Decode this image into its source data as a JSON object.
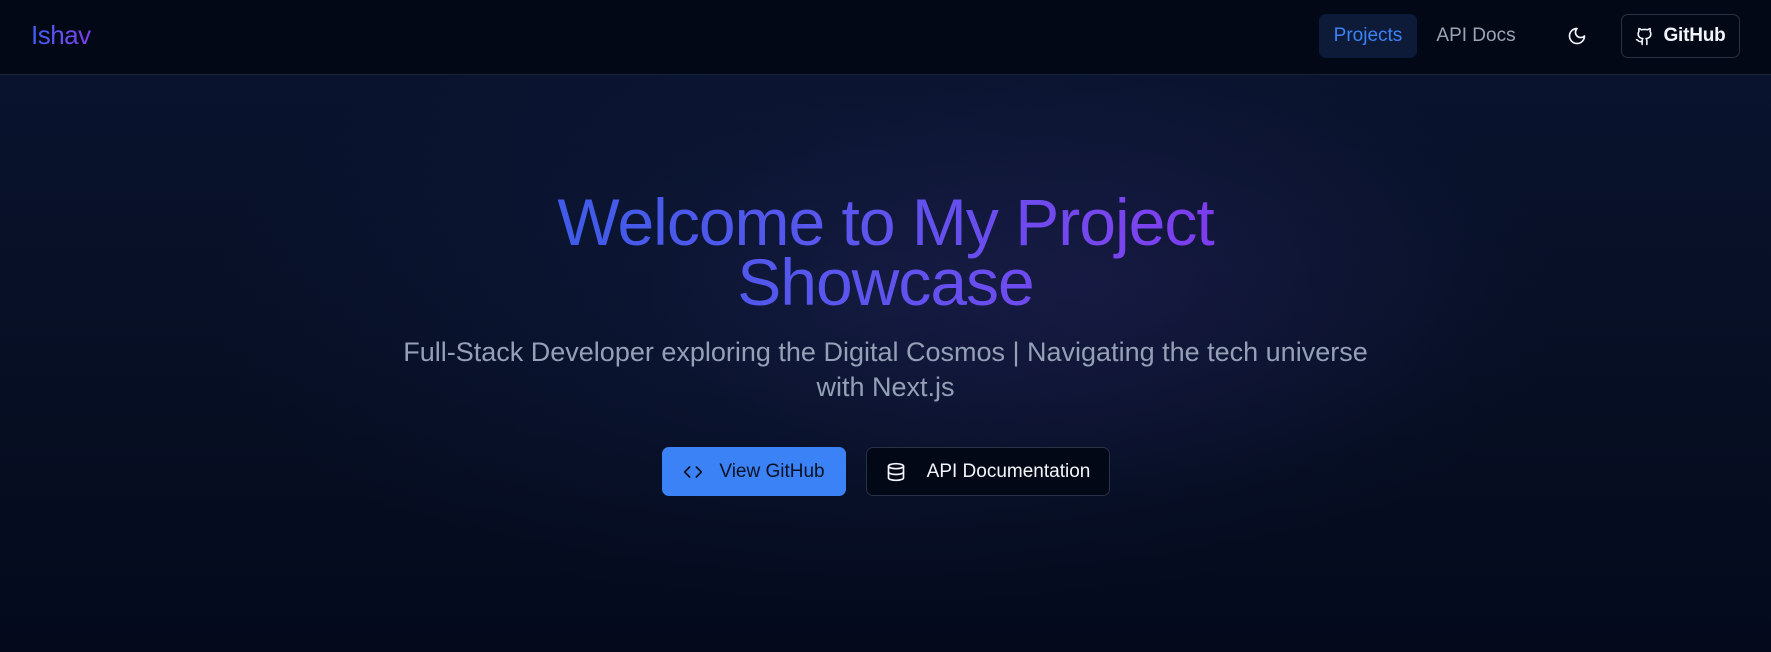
{
  "header": {
    "brand": "Ishav",
    "nav": [
      {
        "label": "Projects",
        "active": true
      },
      {
        "label": "API Docs",
        "active": false
      }
    ],
    "theme_toggle_icon": "moon-icon",
    "github_button": {
      "label": "GitHub",
      "icon": "github-icon"
    }
  },
  "hero": {
    "title": "Welcome to My Project Showcase",
    "subtitle": "Full-Stack Developer exploring the Digital Cosmos | Navigating the tech universe with Next.js",
    "primary_button": {
      "label": "View GitHub",
      "icon": "code-icon"
    },
    "secondary_button": {
      "label": "API Documentation",
      "icon": "database-icon"
    }
  },
  "colors": {
    "background": "#030817",
    "accent": "#3b82f6",
    "gradient_start": "#3d5ce8",
    "gradient_end": "#7c3aed",
    "muted_text": "#93a0b6"
  }
}
